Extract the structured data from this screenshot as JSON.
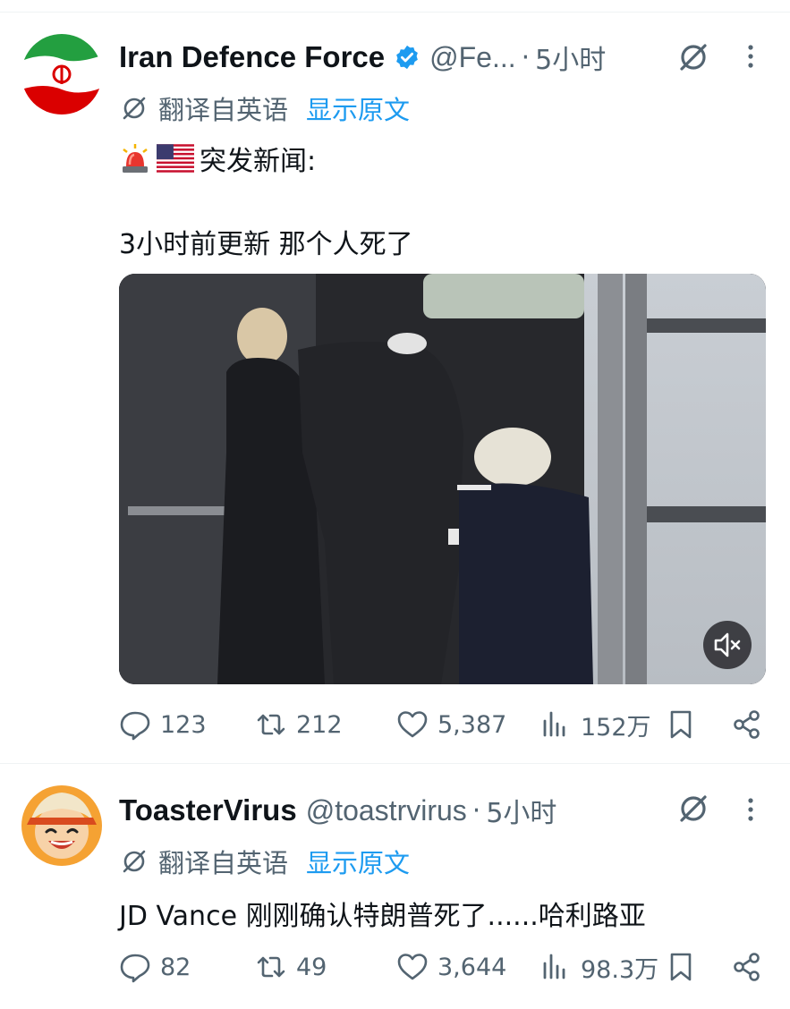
{
  "tweets": [
    {
      "display_name": "Iran Defence Force",
      "verified": true,
      "handle": "@Fe...",
      "dot": "·",
      "time": "5小时",
      "translated_from": "翻译自英语",
      "show_original": "显示原文",
      "text_line1": "突发新闻:",
      "text_line2": "3小时前更新 那个人死了",
      "emojis": [
        "police-siren",
        "us-flag"
      ],
      "media": {
        "type": "video",
        "muted": true
      },
      "stats": {
        "replies": "123",
        "reposts": "212",
        "likes": "5,387",
        "views": "152万"
      }
    },
    {
      "display_name": "ToasterVirus",
      "verified": false,
      "handle": "@toastrvirus",
      "dot": "·",
      "time": "5小时",
      "translated_from": "翻译自英语",
      "show_original": "显示原文",
      "text": "JD Vance 刚刚确认特朗普死了......哈利路亚",
      "stats": {
        "replies": "82",
        "reposts": "49",
        "likes": "3,644",
        "views": "98.3万"
      }
    }
  ],
  "colors": {
    "link": "#1d9bf0",
    "secondary": "#536471",
    "verified": "#1d9bf0",
    "text": "#0f1419"
  }
}
